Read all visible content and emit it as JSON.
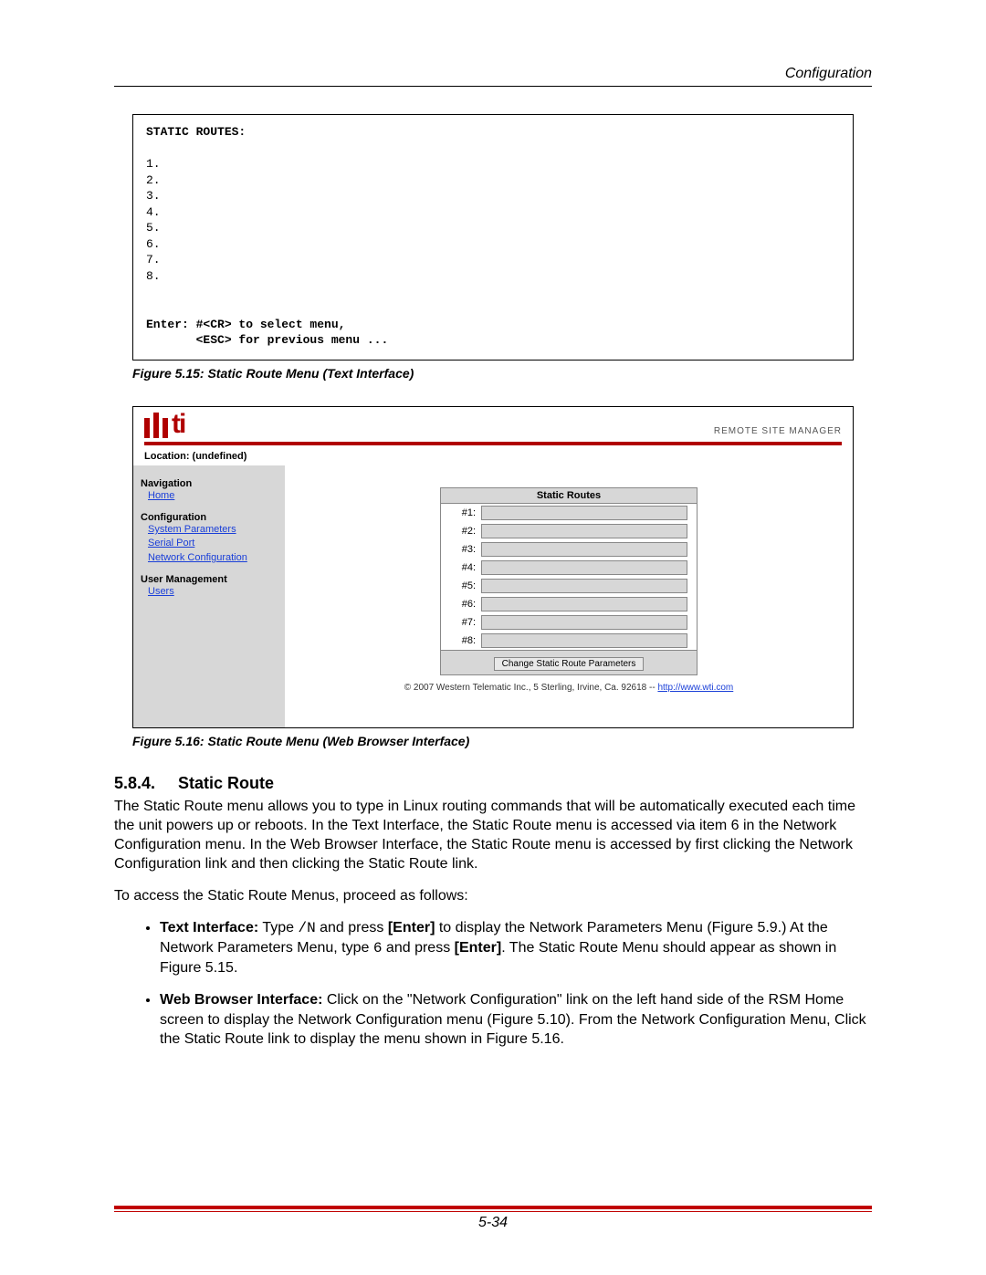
{
  "header": {
    "running": "Configuration"
  },
  "term": {
    "title": "STATIC ROUTES:",
    "rows": [
      "1.",
      "2.",
      "3.",
      "4.",
      "5.",
      "6.",
      "7.",
      "8."
    ],
    "enter1": "Enter: #<CR> to select menu,",
    "enter2": "       <ESC> for previous menu ..."
  },
  "fig15": "Figure 5.15:  Static Route Menu (Text Interface)",
  "webif": {
    "remote": "REMOTE SITE MANAGER",
    "location": "Location: (undefined)",
    "nav_head": "Navigation",
    "nav_home": "Home",
    "cfg_head": "Configuration",
    "cfg_sys": "System Parameters",
    "cfg_serial": "Serial Port",
    "cfg_net": "Network Configuration",
    "um_head": "User Management",
    "um_users": "Users",
    "sr_title": "Static Routes",
    "rows": [
      "#1:",
      "#2:",
      "#3:",
      "#4:",
      "#5:",
      "#6:",
      "#7:",
      "#8:"
    ],
    "btn": "Change Static Route Parameters",
    "foot_pre": "© 2007 Western Telematic Inc., 5 Sterling, Irvine, Ca. 92618 -- ",
    "foot_link": "http://www.wti.com"
  },
  "fig16": "Figure 5.16:  Static Route Menu (Web Browser Interface)",
  "section": {
    "num": "5.8.4.",
    "title": "Static Route",
    "p1": "The Static Route menu allows you to type in Linux routing commands that will be automatically executed each time the unit powers up or reboots.  In the Text Interface, the Static Route menu is accessed via item 6 in the Network Configuration menu.  In the Web Browser Interface, the Static Route menu is accessed by first clicking the Network Configuration link and then clicking the Static Route link.",
    "p2": "To access the Static Route Menus, proceed as follows:",
    "li1_lead": "Text Interface:",
    "li1_a": "  Type ",
    "li1_cmd": "/N",
    "li1_b": " and press ",
    "li1_enter1": "[Enter]",
    "li1_c": " to display the Network Parameters Menu (Figure 5.9.)  At the Network Parameters Menu, type ",
    "li1_six": "6",
    "li1_d": " and press ",
    "li1_enter2": "[Enter]",
    "li1_e": ".  The Static Route Menu should appear as shown in Figure 5.15.",
    "li2_lead": "Web Browser Interface:",
    "li2_a": "  Click on the \"Network Configuration\" link on the left hand side of the RSM Home screen to display the Network Configuration menu (Figure 5.10).  From the Network Configuration Menu, Click the Static Route link to display the menu shown in Figure 5.16."
  },
  "pagenum": "5-34"
}
